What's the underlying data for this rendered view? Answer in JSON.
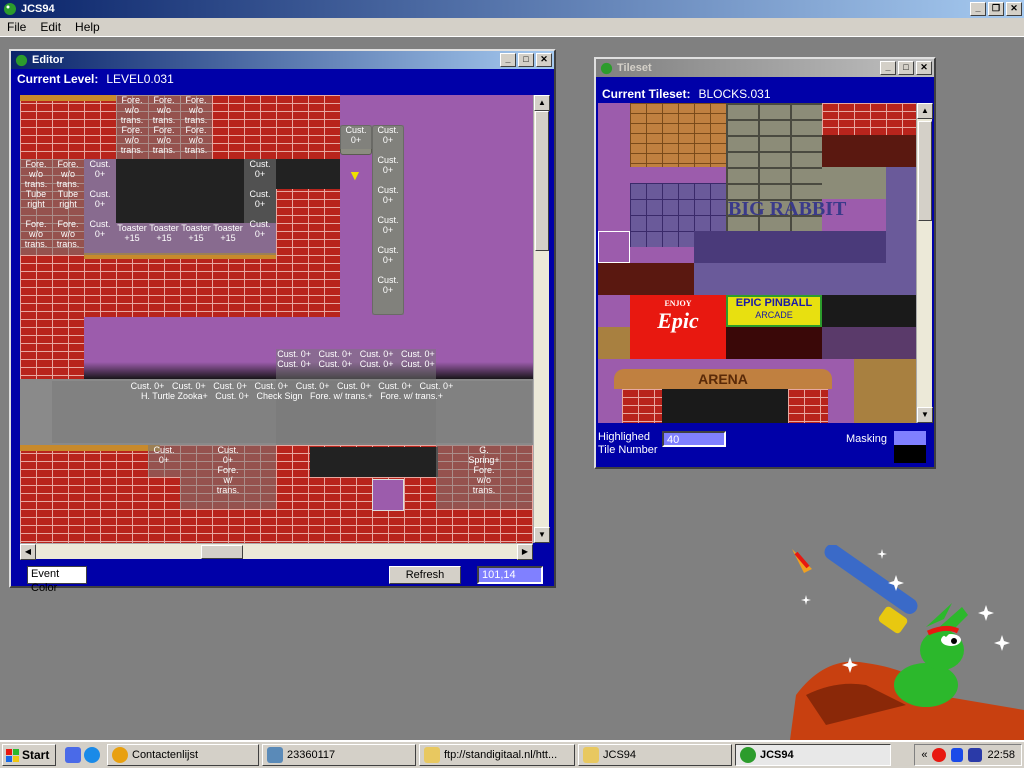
{
  "app": {
    "title": "JCS94"
  },
  "menu": [
    "File",
    "Edit",
    "Help"
  ],
  "editor": {
    "title": "Editor",
    "level_label": "Current Level:",
    "level_value": "LEVEL0.031",
    "event_color_label": "Event Color",
    "refresh_label": "Refresh",
    "coords": "101,14",
    "tiles": [
      [
        "Fore.",
        "w/o",
        "trans.",
        "Fore.",
        "w/o",
        "trans."
      ],
      [
        "Fore.",
        "w/o",
        "trans.",
        "Fore.",
        "w/o",
        "trans."
      ],
      [
        "Fore.",
        "w/o",
        "trans.",
        "Fore.",
        "w/o",
        "trans."
      ]
    ],
    "labels": {
      "fore_wo_trans": "Fore. w/o trans.",
      "fore_w_trans": "Fore. w/ trans.",
      "fore_wtrans_plus": "Fore. w/ trans.+",
      "cust0": "Cust. 0+",
      "cust": "Cust.",
      "toaster": "Toaster +15",
      "tube_right": "Fore. w/o trans. Tube right",
      "h_turtle": "H. Turtle",
      "zooka": "Zooka+",
      "check_sign": "Check Sign",
      "g_spring": "G. Spring+"
    }
  },
  "tileset": {
    "title": "Tileset",
    "tileset_label": "Current Tileset:",
    "tileset_value": "BLOCKS.031",
    "highlighted_label": "Highlighed Tile Number",
    "highlighted_line1": "Highlighed",
    "highlighted_line2": "Tile Number",
    "highlighted_value": "40",
    "masking_label": "Masking",
    "sign_enjoy": "ENJOY",
    "sign_epic": "Epic",
    "sign_pinball": "EPIC PINBALL",
    "sign_arcade": "ARCADE",
    "sign_arena": "ARENA",
    "sign_big": "BIG RABBIT"
  },
  "taskbar": {
    "start": "Start",
    "items": [
      "Contactenlijst",
      "23360117",
      "ftp://standigitaal.nl/htt...",
      "JCS94",
      "JCS94"
    ],
    "clock": "22:58"
  },
  "colors": {
    "title_bar": "#0a246a",
    "blue_panel": "#0000a8",
    "brick": "#b8241c",
    "purple": "#9c5cac"
  }
}
